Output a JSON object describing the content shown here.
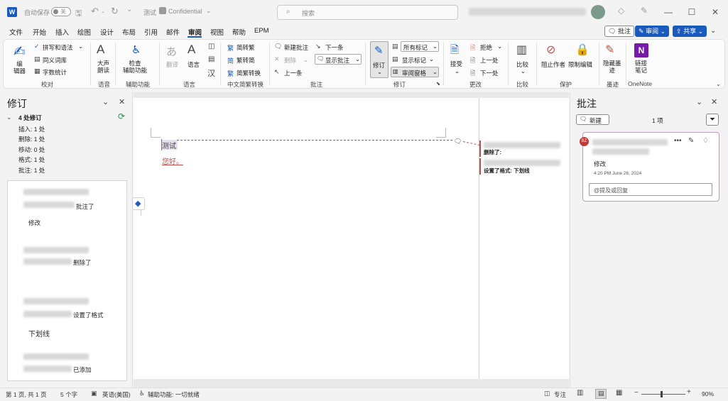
{
  "titlebar": {
    "autosave_label": "自动保存",
    "autosave_state": "关",
    "doc_name": "测试",
    "sensitivity": "Confidential",
    "search_placeholder": "搜索"
  },
  "menu": {
    "tabs": [
      "文件",
      "开始",
      "插入",
      "绘图",
      "设计",
      "布局",
      "引用",
      "邮件",
      "审阅",
      "视图",
      "帮助",
      "EPM"
    ],
    "active_tab": "审阅",
    "comments_btn": "批注",
    "review_btn": "审阅",
    "share_btn": "共享"
  },
  "ribbon": {
    "editor": "编\n辑器",
    "spelling": "拼写和语法",
    "thesaurus": "同义词库",
    "wordcount": "字数统计",
    "group_proofing": "校对",
    "read_aloud": "大声\n朗读",
    "group_speech": "语音",
    "check_access": "检查\n辅助功能",
    "group_access": "辅助功能",
    "translate": "翻译",
    "language": "语言",
    "group_language": "语言",
    "to_traditional": "简转繁",
    "to_simplified": "繁转简",
    "convert": "简繁转换",
    "group_chinese": "中文简繁转换",
    "new_comment": "新建批注",
    "delete": "删除",
    "previous": "上一条",
    "next": "下一条",
    "show_comments": "显示批注",
    "group_comments": "批注",
    "track_changes": "修订",
    "all_markup": "所有标记",
    "show_markup": "显示标记",
    "review_pane": "审阅窗格",
    "group_tracking": "修订",
    "accept": "接受",
    "reject": "拒绝",
    "prev_change": "上一处",
    "next_change": "下一处",
    "group_changes": "更改",
    "compare": "比较",
    "group_compare": "比较",
    "block_authors": "阻止作者",
    "restrict_editing": "限制编辑",
    "group_protect": "保护",
    "hide_ink": "隐藏墨\n迹",
    "group_ink": "墨迹",
    "linked_notes": "链接\n笔记",
    "group_onenote": "OneNote"
  },
  "left_pane": {
    "title": "修订",
    "summary": "4 处修订",
    "insertions": "插入: 1 处",
    "deletions": "删除: 1 处",
    "moves": "移动: 0 处",
    "formatting": "格式: 1 处",
    "comments": "批注: 1 处",
    "items": [
      {
        "action": "批注了",
        "content": "修改"
      },
      {
        "action": "删除了",
        "content": ""
      },
      {
        "action": "设置了格式",
        "content": "下划线"
      },
      {
        "action": "已添加",
        "content": ""
      }
    ]
  },
  "document": {
    "line1": "测试",
    "line2": "您好。",
    "balloon1": "删除了:",
    "balloon2": "设置了格式: 下划线"
  },
  "right_pane": {
    "title": "批注",
    "new_btn": "新建",
    "count": "1 项",
    "comment": {
      "initials": "BZ",
      "text": "修改",
      "time": "4:20 PM June 26, 2024",
      "reply_placeholder": "@提及或回复"
    }
  },
  "status": {
    "page": "第 1 页, 共 1 页",
    "words": "5 个字",
    "lang": "英语(美国)",
    "access": "辅助功能: 一切就绪",
    "focus": "专注",
    "zoom": "90%"
  },
  "colors": {
    "accent": "#185abd",
    "revision": "#c0504d",
    "comment_border": "#b4a0b4"
  }
}
